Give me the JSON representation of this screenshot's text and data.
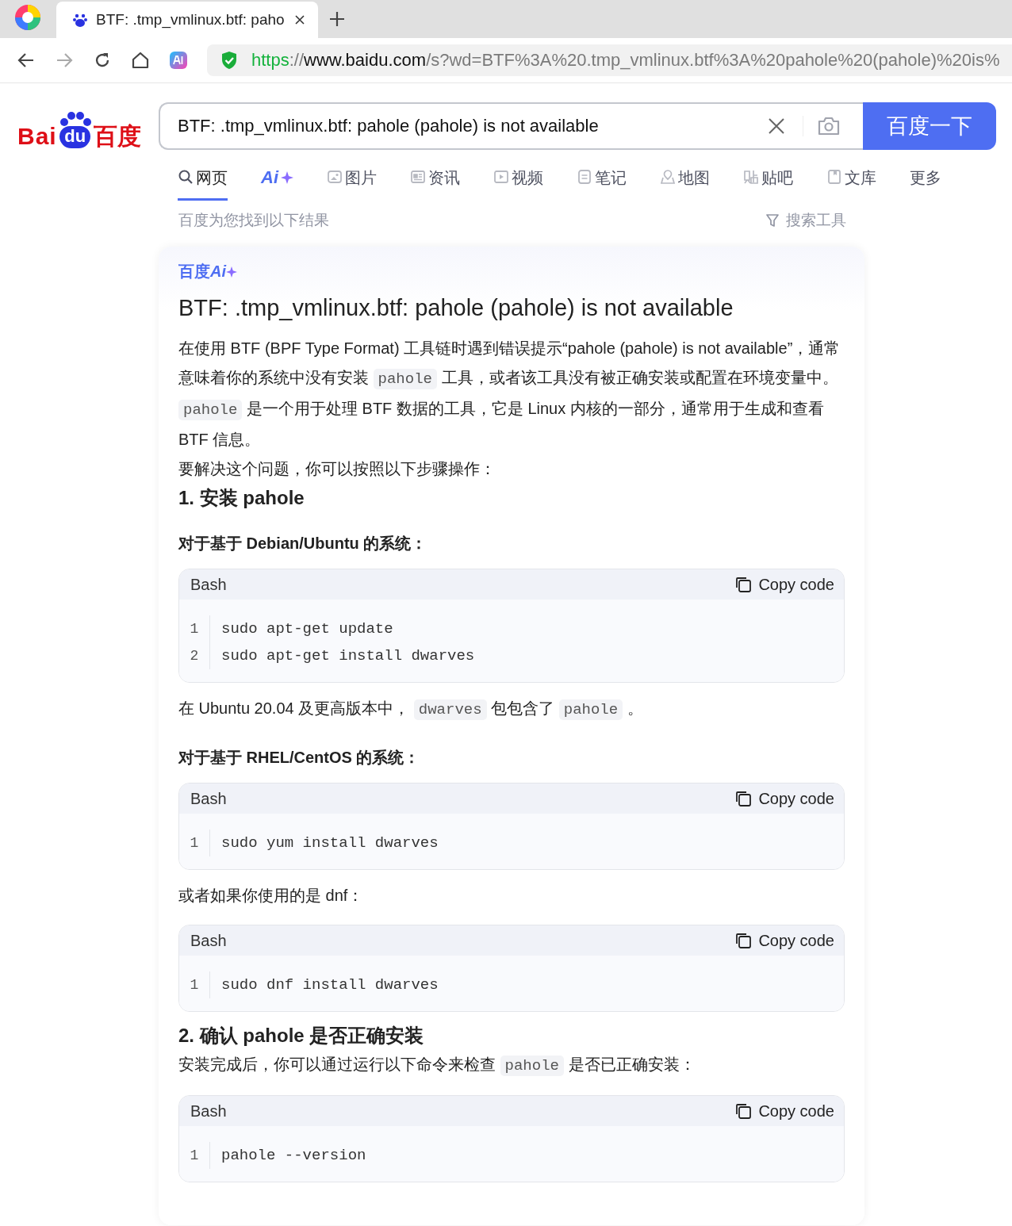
{
  "browser": {
    "tab": {
      "title": "BTF: .tmp_vmlinux.btf: paho"
    },
    "address": {
      "scheme": "https",
      "separator": "://",
      "host": "www.baidu.com",
      "path": "/s?wd=BTF%3A%20.tmp_vmlinux.btf%3A%20pahole%20(pahole)%20is%"
    }
  },
  "logo": {
    "left": "Bai",
    "paw": "du",
    "right": "百度"
  },
  "search": {
    "value": "BTF: .tmp_vmlinux.btf: pahole (pahole) is not available",
    "button": "百度一下"
  },
  "nav_tabs": [
    {
      "kind": "web",
      "label": "网页",
      "selected": true
    },
    {
      "kind": "ai",
      "label": "Ai",
      "selected": false
    },
    {
      "kind": "image",
      "label": "图片",
      "selected": false
    },
    {
      "kind": "news",
      "label": "资讯",
      "selected": false
    },
    {
      "kind": "video",
      "label": "视频",
      "selected": false
    },
    {
      "kind": "notes",
      "label": "笔记",
      "selected": false
    },
    {
      "kind": "map",
      "label": "地图",
      "selected": false
    },
    {
      "kind": "tieba",
      "label": "贴吧",
      "selected": false
    },
    {
      "kind": "wenku",
      "label": "文库",
      "selected": false
    },
    {
      "kind": "more",
      "label": "更多",
      "selected": false
    }
  ],
  "result_info": "百度为您找到以下结果",
  "search_tools": "搜索工具",
  "answer": {
    "brand": "百度",
    "brand_ai": "Ai",
    "title": "BTF: .tmp_vmlinux.btf: pahole (pahole) is not available",
    "blocks": [
      {
        "kind": "paragraph",
        "parts": [
          {
            "kind": "text",
            "text": "在使用 BTF (BPF Type Format) 工具链时遇到错误提示“pahole (pahole) is not available”，通常意味着你的系统中没有安装 "
          },
          {
            "kind": "code",
            "text": "pahole"
          },
          {
            "kind": "text",
            "text": " 工具，或者该工具没有被正确安装或配置在环境变量中。 "
          },
          {
            "kind": "code",
            "text": "pahole"
          },
          {
            "kind": "text",
            "text": " 是一个用于处理 BTF 数据的工具，它是 Linux 内核的一部分，通常用于生成和查看 BTF 信息。"
          }
        ]
      },
      {
        "kind": "line",
        "parts": [
          {
            "kind": "text",
            "text": "要解决这个问题，你可以按照以下步骤操作："
          }
        ]
      },
      {
        "kind": "heading",
        "text": "1. 安装 pahole"
      },
      {
        "kind": "subheading",
        "text": "对于基于 Debian/Ubuntu 的系统："
      },
      {
        "kind": "code",
        "language": "Bash",
        "copy_label": "Copy code",
        "lines": [
          {
            "number": "1",
            "code": "sudo apt-get update"
          },
          {
            "number": "2",
            "code": "sudo apt-get install dwarves"
          }
        ]
      },
      {
        "kind": "line",
        "parts": [
          {
            "kind": "text",
            "text": "在 Ubuntu 20.04 及更高版本中， "
          },
          {
            "kind": "code",
            "text": "dwarves"
          },
          {
            "kind": "text",
            "text": " 包包含了 "
          },
          {
            "kind": "code",
            "text": "pahole"
          },
          {
            "kind": "text",
            "text": " 。"
          }
        ]
      },
      {
        "kind": "subheading",
        "text": "对于基于 RHEL/CentOS 的系统："
      },
      {
        "kind": "code",
        "language": "Bash",
        "copy_label": "Copy code",
        "lines": [
          {
            "number": "1",
            "code": "sudo yum install dwarves"
          }
        ]
      },
      {
        "kind": "line",
        "parts": [
          {
            "kind": "text",
            "text": "或者如果你使用的是 dnf："
          }
        ]
      },
      {
        "kind": "code",
        "language": "Bash",
        "copy_label": "Copy code",
        "lines": [
          {
            "number": "1",
            "code": "sudo dnf install dwarves"
          }
        ]
      },
      {
        "kind": "heading",
        "text": "2. 确认 pahole 是否正确安装"
      },
      {
        "kind": "line",
        "parts": [
          {
            "kind": "text",
            "text": "安装完成后，你可以通过运行以下命令来检查 "
          },
          {
            "kind": "code",
            "text": "pahole"
          },
          {
            "kind": "text",
            "text": " 是否已正确安装："
          }
        ]
      },
      {
        "kind": "code",
        "language": "Bash",
        "copy_label": "Copy code",
        "lines": [
          {
            "number": "1",
            "code": "pahole --version"
          }
        ]
      }
    ]
  }
}
